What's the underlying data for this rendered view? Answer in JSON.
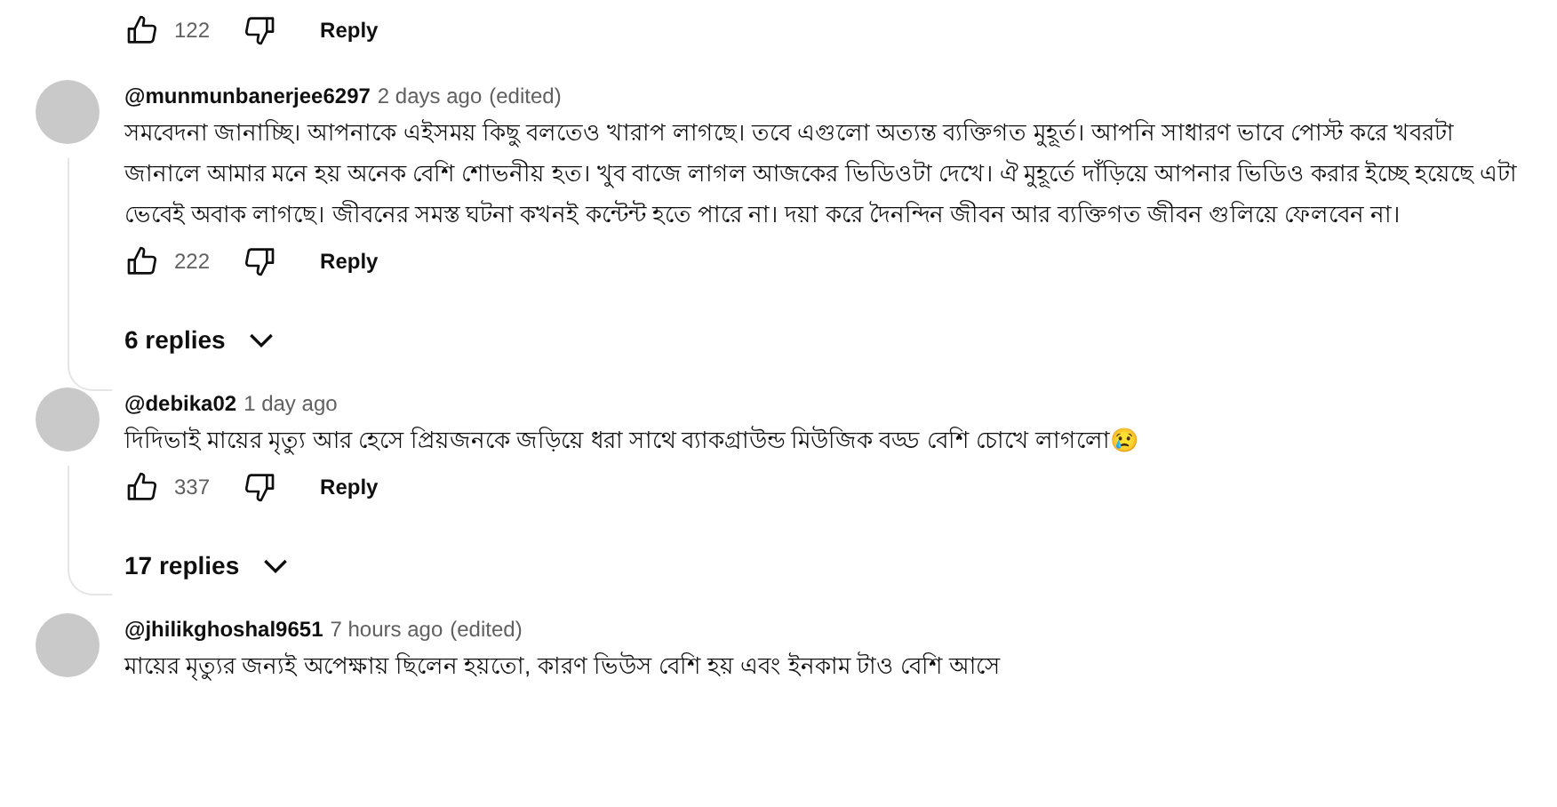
{
  "top_actions": {
    "likes": "122",
    "reply": "Reply"
  },
  "comments": [
    {
      "author": "@munmunbanerjee6297",
      "time": "2 days ago",
      "edited": "(edited)",
      "text": "সমবেদনা জানাচ্ছি। আপনাকে এইসময় কিছু বলতেও খারাপ লাগছে। তবে এগুলো অত্যন্ত ব্যক্তিগত মুহূর্ত। আপনি সাধারণ ভাবে পোস্ট করে খবরটা জানালে আমার মনে হয় অনেক বেশি শোভনীয় হত। খুব বাজে লাগল আজকের ভিডিওটা দেখে। ঐ মুহূর্তে দাঁড়িয়ে আপনার ভিডিও করার ইচ্ছে হয়েছে এটা ভেবেই অবাক লাগছে। জীবনের সমস্ত ঘটনা কখনই কন্টেন্ট হতে পারে না। দয়া করে দৈনন্দিন জীবন আর ব্যক্তিগত জীবন গুলিয়ে ফেলবেন না।",
      "likes": "222",
      "reply": "Reply",
      "replies": "6 replies"
    },
    {
      "author": "@debika02",
      "time": "1 day ago",
      "text": "দিদিভাই মায়ের মৃত্যু আর হেসে প্রিয়জনকে জড়িয়ে ধরা সাথে ব্যাকগ্রাউন্ড মিউজিক বড্ড বেশি চোখে লাগলো😢",
      "likes": "337",
      "reply": "Reply",
      "replies": "17 replies"
    },
    {
      "author": "@jhilikghoshal9651",
      "time": "7 hours ago",
      "edited": "(edited)",
      "text": "মায়ের মৃত্যুর জন্যই অপেক্ষায় ছিলেন হয়তো, কারণ ভিউস বেশি হয় এবং ইনকাম টাও বেশি আসে"
    }
  ]
}
